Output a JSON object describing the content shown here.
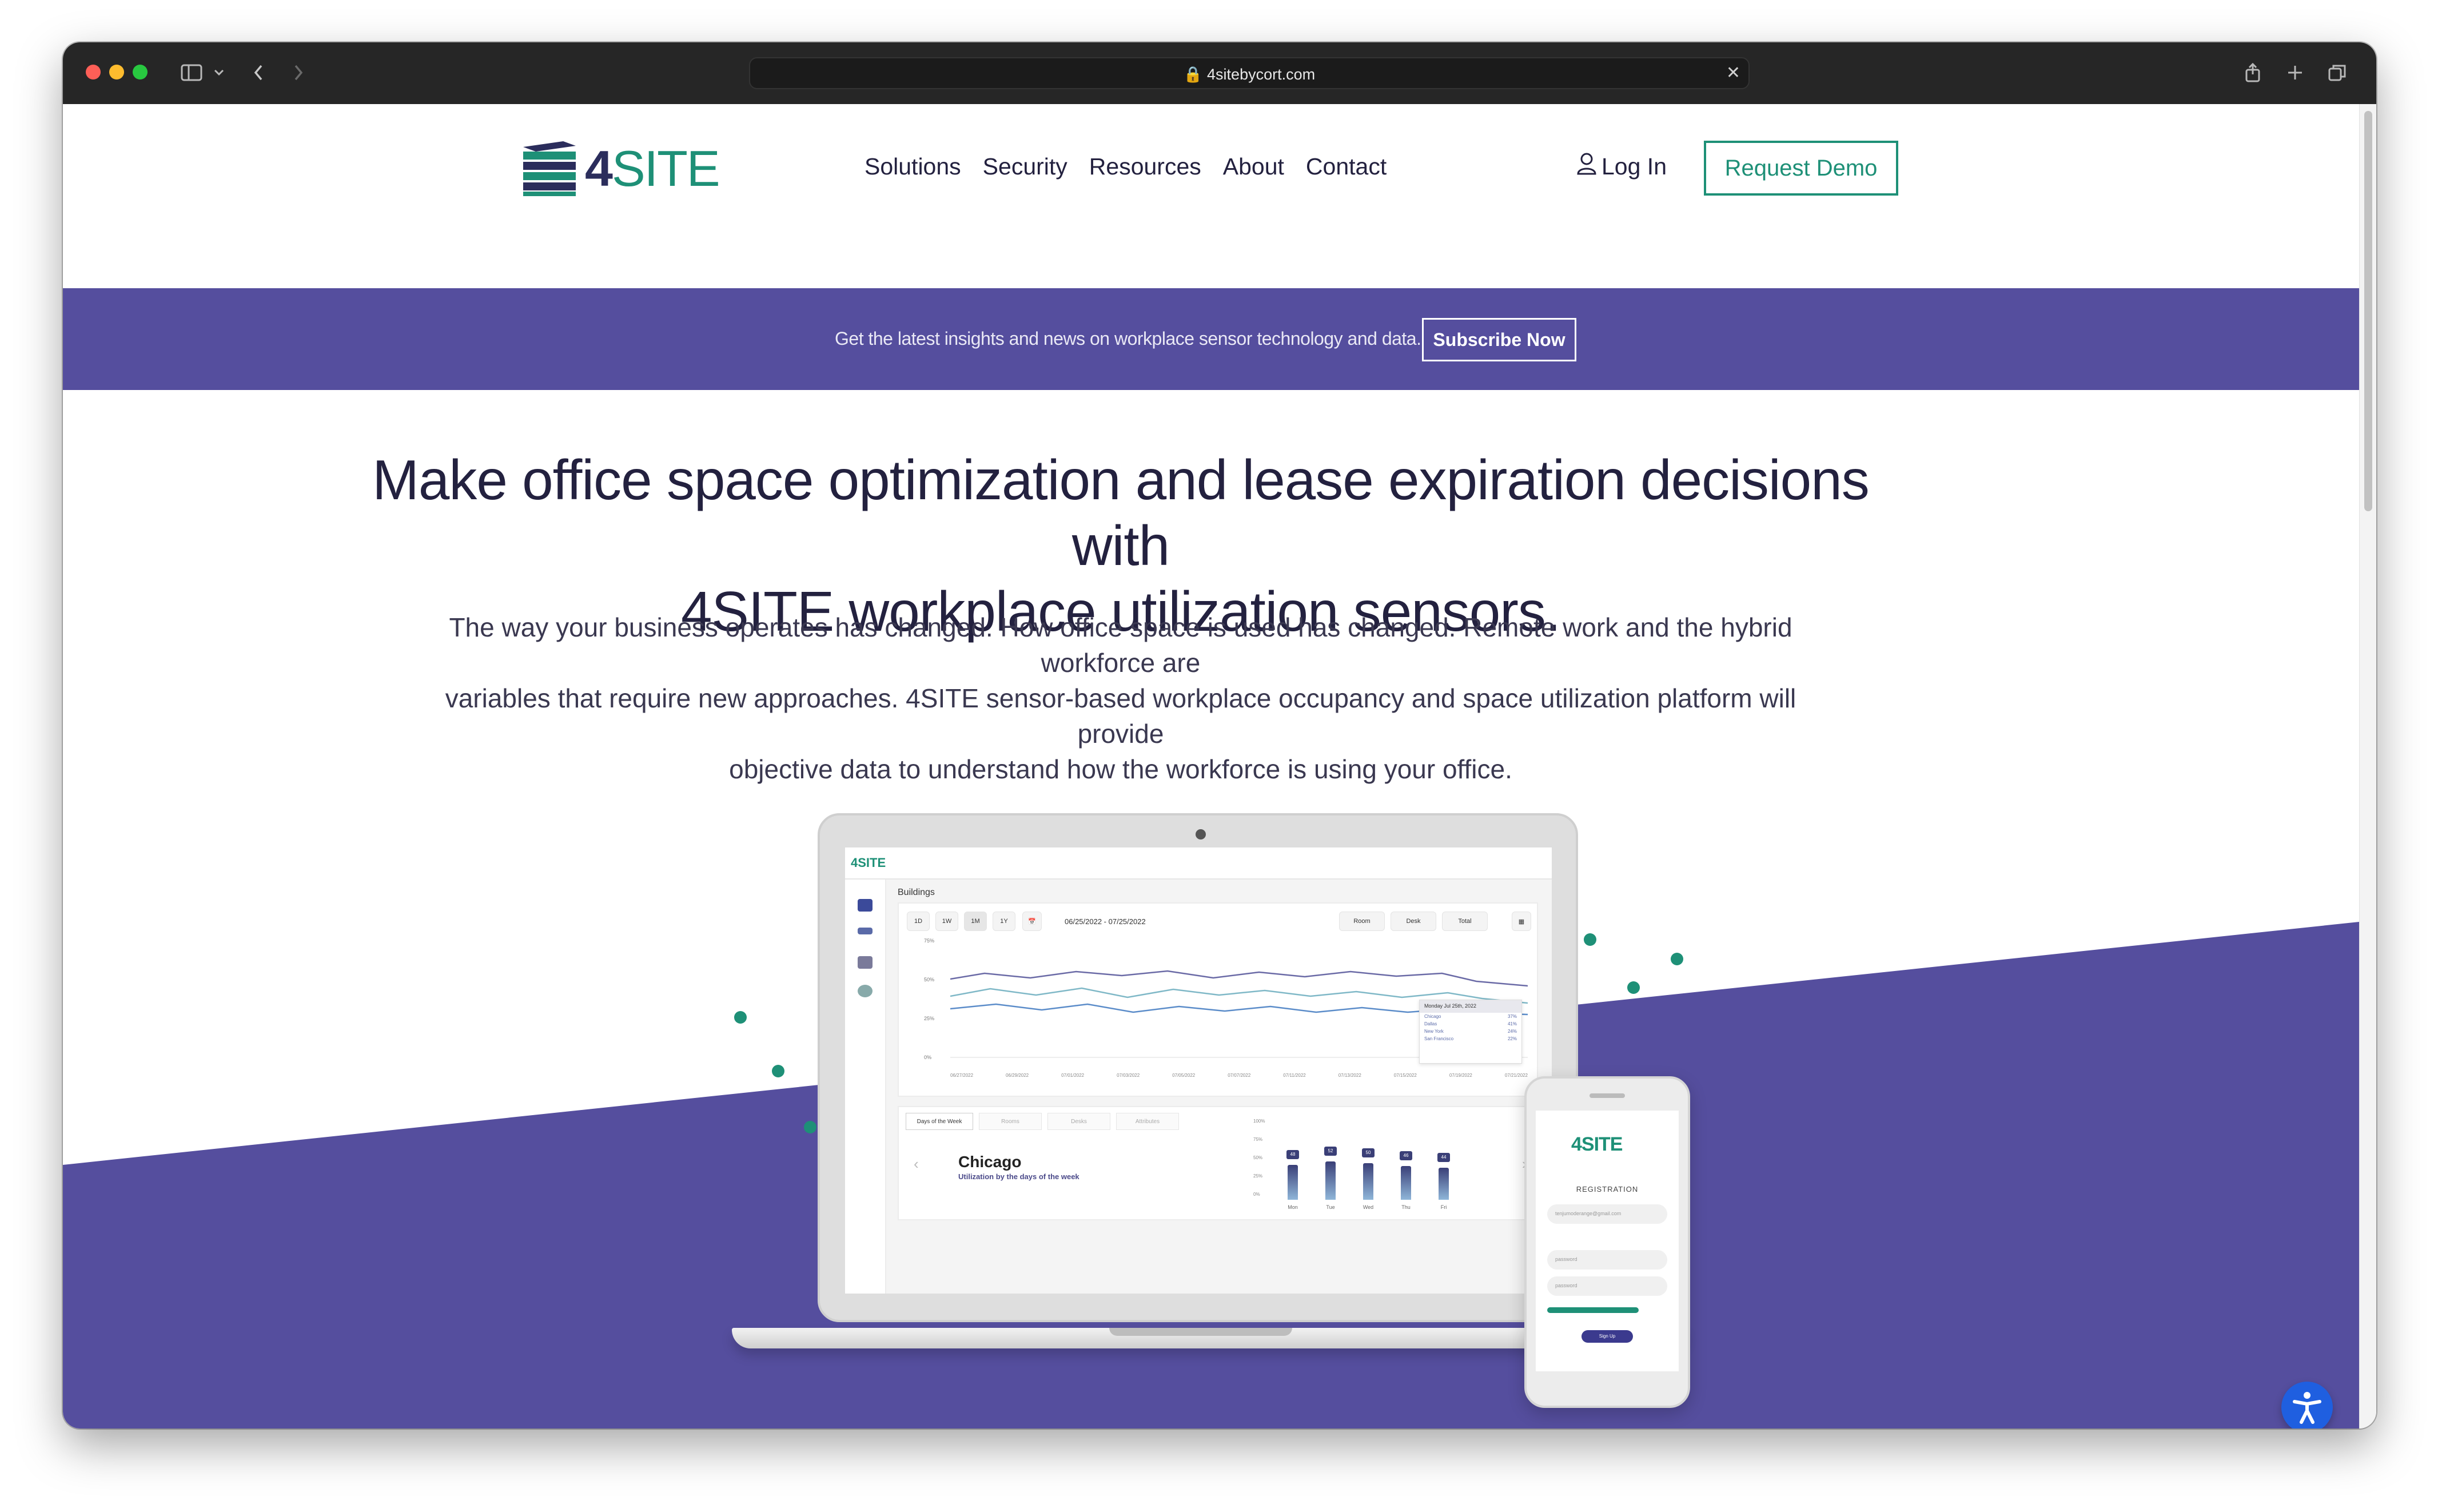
{
  "browser": {
    "url": "4sitebycort.com"
  },
  "header": {
    "logo_text": "4SITE",
    "nav": [
      "Solutions",
      "Security",
      "Resources",
      "About",
      "Contact"
    ],
    "login_label": "Log In",
    "demo_label": "Request Demo"
  },
  "banner": {
    "text": "Get the latest insights and news on workplace sensor technology and data.",
    "button_label": "Subscribe Now"
  },
  "hero": {
    "title_line1": "Make office space optimization and lease expiration decisions with",
    "title_line2": "4SITE workplace utilization sensors.",
    "body_line1": "The way your business operates has changed. How office space is used has changed. Remote work and the hybrid workforce are",
    "body_line2": "variables that require new approaches. 4SITE sensor-based workplace occupancy and space utilization platform will provide",
    "body_line3": "objective data to understand how the workforce is using your office."
  },
  "app_mock": {
    "logo": "4SITE",
    "section_title": "Buildings",
    "range_buttons": [
      "1D",
      "1W",
      "1M",
      "1Y"
    ],
    "date_range": "06/25/2022  -  07/25/2022",
    "filters": [
      "Room",
      "Desk",
      "Total"
    ],
    "y_ticks": [
      "75%",
      "50%",
      "25%",
      "0%"
    ],
    "x_ticks": [
      "06/27/2022",
      "06/29/2022",
      "07/01/2022",
      "07/03/2022",
      "07/05/2022",
      "07/07/2022",
      "07/11/2022",
      "07/13/2022",
      "07/15/2022",
      "07/19/2022",
      "07/21/2022"
    ],
    "tooltip": {
      "header": "Monday Jul 25th, 2022",
      "rows": [
        {
          "name": "Chicago",
          "value": "37%"
        },
        {
          "name": "Dallas",
          "value": "41%"
        },
        {
          "name": "New York",
          "value": "24%"
        },
        {
          "name": "San Francisco",
          "value": "22%"
        }
      ]
    },
    "tabs": [
      "Days of the Week",
      "Rooms",
      "Desks",
      "Attributes"
    ],
    "city": "Chicago",
    "city_subtitle": "Utilization by the days of the week",
    "bar_axis": [
      "100%",
      "75%",
      "50%",
      "25%",
      "0%"
    ],
    "days": [
      "Mon",
      "Tue",
      "Wed",
      "Thu",
      "Fri"
    ],
    "day_values": [
      48,
      52,
      50,
      46,
      44
    ]
  },
  "phone_mock": {
    "logo": "4SITE",
    "registration_label": "REGISTRATION",
    "email_placeholder": "tenjumoderange@gmail.com",
    "field2_placeholder": "password",
    "field3_placeholder": "password",
    "button_label": "Sign Up"
  },
  "colors": {
    "brand_purple": "#554e9e",
    "brand_green": "#1e9077",
    "navy": "#23213f"
  }
}
